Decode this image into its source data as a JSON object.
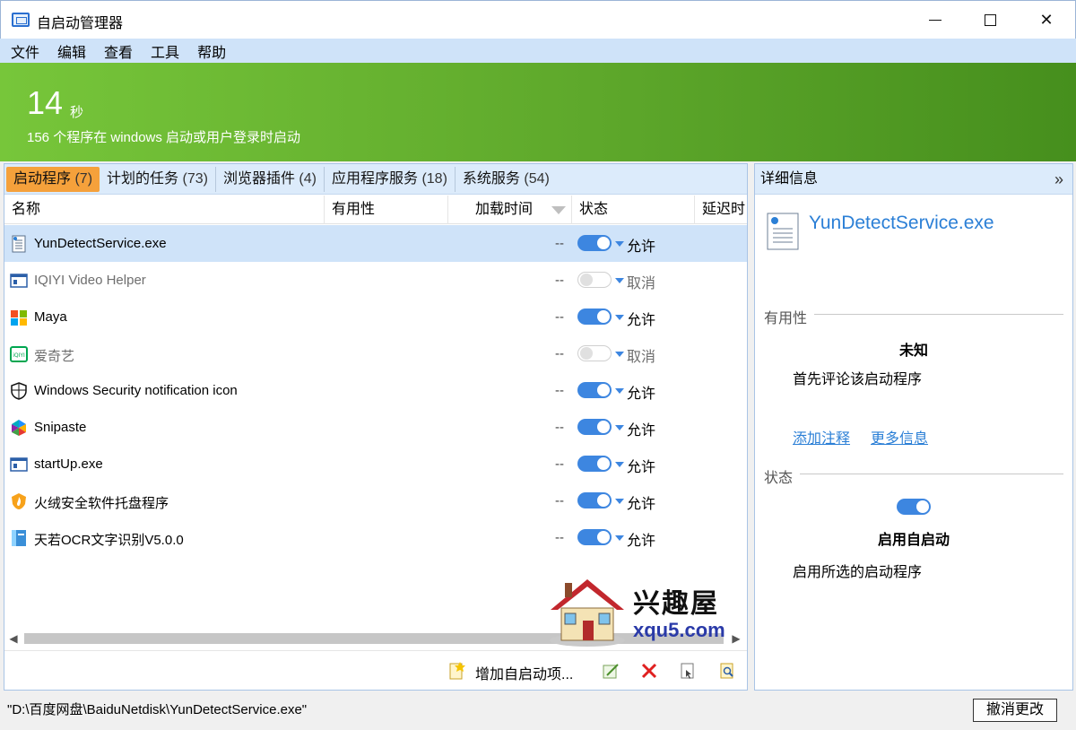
{
  "window": {
    "title": "自启动管理器"
  },
  "menu": [
    "文件",
    "编辑",
    "查看",
    "工具",
    "帮助"
  ],
  "banner": {
    "seconds": "14",
    "seconds_unit": "秒",
    "subtitle": "156 个程序在 windows 启动或用户登录时启动"
  },
  "tabs": [
    {
      "label": "启动程序",
      "count": "(7)"
    },
    {
      "label": "计划的任务",
      "count": "(73)"
    },
    {
      "label": "浏览器插件",
      "count": "(4)"
    },
    {
      "label": "应用程序服务",
      "count": "(18)"
    },
    {
      "label": "系统服务",
      "count": "(54)"
    }
  ],
  "columns": {
    "name": "名称",
    "usefulness": "有用性",
    "load_time": "加载时间",
    "state": "状态",
    "delay": "延迟时"
  },
  "rows": [
    {
      "name": "YunDetectService.exe",
      "load": "--",
      "state": "允许",
      "enabled": true,
      "icon": "document-icon"
    },
    {
      "name": "IQIYI Video Helper",
      "load": "--",
      "state": "取消",
      "enabled": false,
      "icon": "window-icon"
    },
    {
      "name": "Maya",
      "load": "--",
      "state": "允许",
      "enabled": true,
      "icon": "windows-logo-icon"
    },
    {
      "name": "爱奇艺",
      "load": "--",
      "state": "取消",
      "enabled": false,
      "icon": "iqiyi-icon"
    },
    {
      "name": "Windows Security notification icon",
      "load": "--",
      "state": "允许",
      "enabled": true,
      "icon": "shield-icon"
    },
    {
      "name": "Snipaste",
      "load": "--",
      "state": "允许",
      "enabled": true,
      "icon": "snipaste-icon"
    },
    {
      "name": "startUp.exe",
      "load": "--",
      "state": "允许",
      "enabled": true,
      "icon": "window-icon"
    },
    {
      "name": "火绒安全软件托盘程序",
      "load": "--",
      "state": "允许",
      "enabled": true,
      "icon": "huorong-icon"
    },
    {
      "name": "天若OCR文字识别V5.0.0",
      "load": "--",
      "state": "允许",
      "enabled": true,
      "icon": "ocr-icon"
    }
  ],
  "toolbar": {
    "add_label": "增加自启动项..."
  },
  "watermark": {
    "line1": "兴趣屋",
    "line2": "xqu5.com"
  },
  "details": {
    "header": "详细信息",
    "file_name": "YunDetectService.exe",
    "usefulness_label": "有用性",
    "usefulness_value": "未知",
    "usefulness_desc": "首先评论该启动程序",
    "add_note": "添加注释",
    "more_info": "更多信息",
    "state_label": "状态",
    "state_value": "启用自启动",
    "state_desc": "启用所选的启动程序"
  },
  "statusbar": {
    "path": "\"D:\\百度网盘\\BaiduNetdisk\\YunDetectService.exe\"",
    "undo_label": "撤消更改"
  }
}
